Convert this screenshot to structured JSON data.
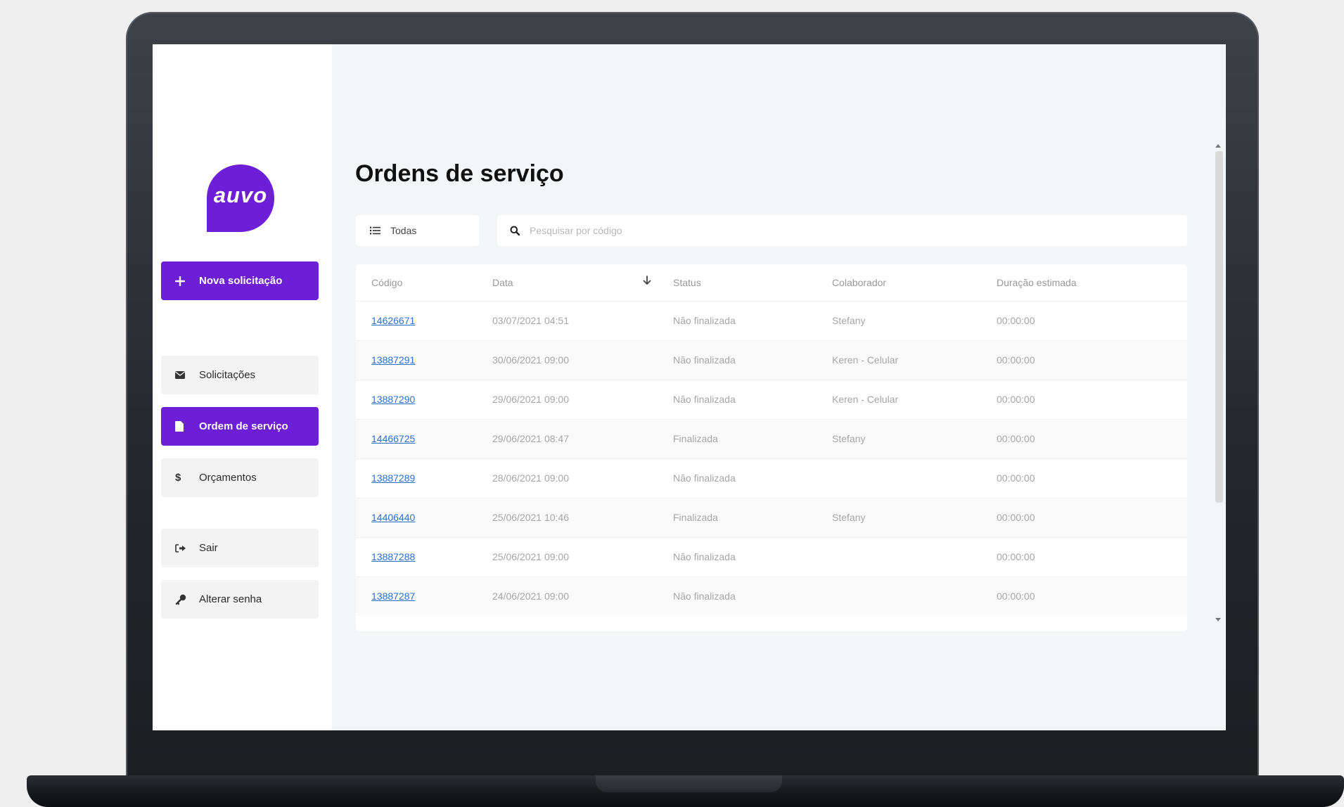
{
  "brand": {
    "logo_text": "auvo",
    "accent_color": "#6c1fd6"
  },
  "sidebar": {
    "new_request_label": "Nova solicitação",
    "items": [
      {
        "label": "Solicitações",
        "icon": "envelope-icon"
      },
      {
        "label": "Ordem de serviço",
        "icon": "document-icon",
        "active": true
      },
      {
        "label": "Orçamentos",
        "icon": "dollar-icon"
      },
      {
        "label": "Sair",
        "icon": "sign-out-icon"
      },
      {
        "label": "Alterar senha",
        "icon": "key-icon"
      }
    ]
  },
  "main": {
    "title": "Ordens de serviço",
    "filter_label": "Todas",
    "search_placeholder": "Pesquisar por código"
  },
  "table": {
    "columns": [
      "Código",
      "Data",
      "Status",
      "Colaborador",
      "Duração estimada"
    ],
    "sort_column": "Data",
    "rows": [
      {
        "code": "14626671",
        "date": "03/07/2021 04:51",
        "status": "Não finalizada",
        "collaborator": "Stefany",
        "duration": "00:00:00"
      },
      {
        "code": "13887291",
        "date": "30/06/2021 09:00",
        "status": "Não finalizada",
        "collaborator": "Keren - Celular",
        "duration": "00:00:00"
      },
      {
        "code": "13887290",
        "date": "29/06/2021 09:00",
        "status": "Não finalizada",
        "collaborator": "Keren - Celular",
        "duration": "00:00:00"
      },
      {
        "code": "14466725",
        "date": "29/06/2021 08:47",
        "status": "Finalizada",
        "collaborator": "Stefany",
        "duration": "00:00:00"
      },
      {
        "code": "13887289",
        "date": "28/06/2021 09:00",
        "status": "Não finalizada",
        "collaborator": "",
        "duration": "00:00:00"
      },
      {
        "code": "14406440",
        "date": "25/06/2021 10:46",
        "status": "Finalizada",
        "collaborator": "Stefany",
        "duration": "00:00:00"
      },
      {
        "code": "13887288",
        "date": "25/06/2021 09:00",
        "status": "Não finalizada",
        "collaborator": "",
        "duration": "00:00:00"
      },
      {
        "code": "13887287",
        "date": "24/06/2021 09:00",
        "status": "Não finalizada",
        "collaborator": "",
        "duration": "00:00:00"
      }
    ]
  }
}
